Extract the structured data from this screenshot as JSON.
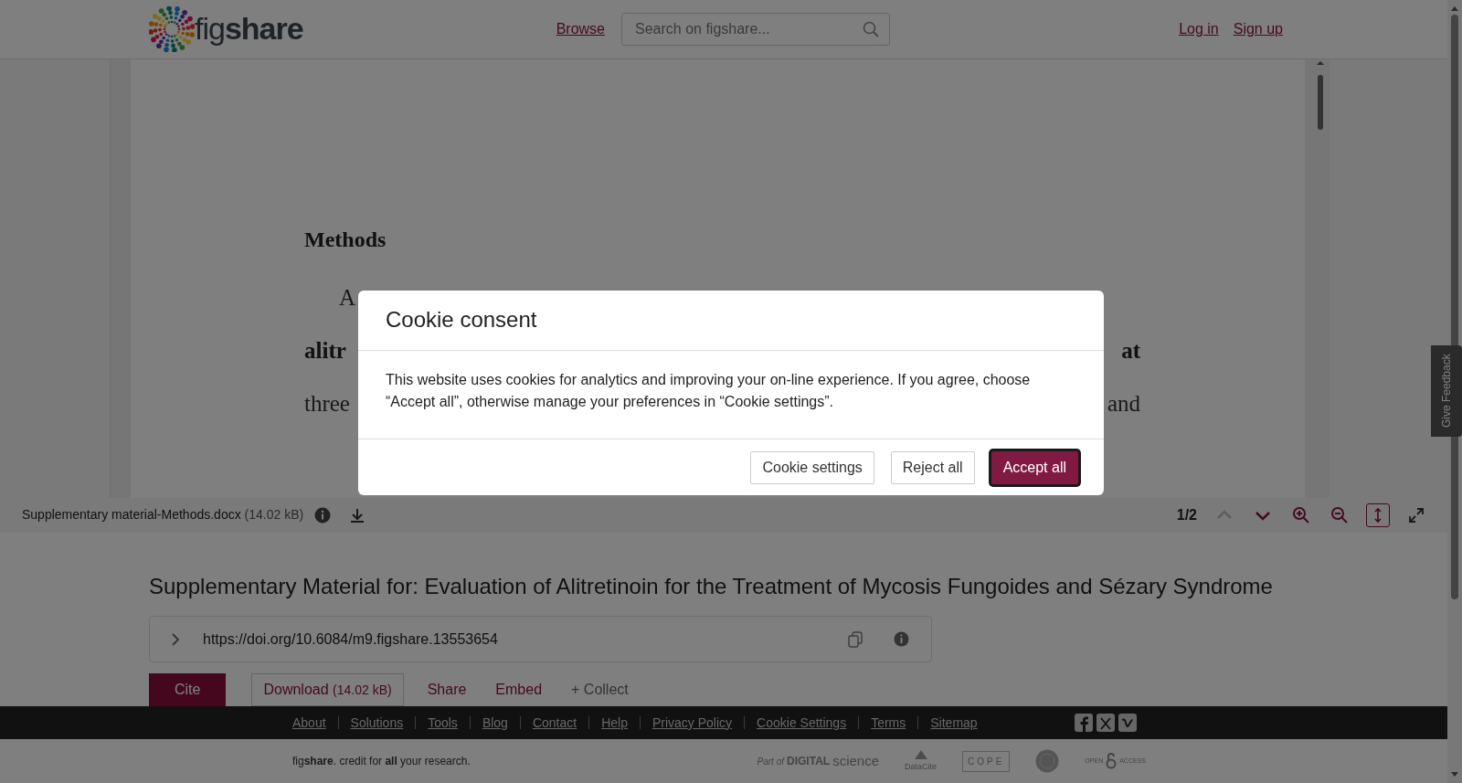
{
  "header": {
    "logo": "fig**share**",
    "nav": [
      {
        "label": "Browse"
      }
    ],
    "search": {
      "placeholder": "Search on figshare..."
    },
    "auth": [
      {
        "label": "Log in"
      },
      {
        "label": "Sign up"
      }
    ]
  },
  "document": {
    "heading": "Methods",
    "lines": [
      {
        "left": "A"
      },
      {
        "left": "alitr",
        "right": "at",
        "bold": true
      },
      {
        "left": "three",
        "right": "and",
        "bold": false
      }
    ]
  },
  "viewer_toolbar": {
    "file_name": "Supplementary material-Methods.docx",
    "file_size": "(14.02 kB)",
    "page": "1/2",
    "tools": [
      {
        "kind": "prev",
        "disabled": true,
        "selected": false
      },
      {
        "kind": "next",
        "disabled": false,
        "selected": false
      },
      {
        "kind": "zoom-in",
        "disabled": false,
        "selected": false
      },
      {
        "kind": "zoom-out",
        "disabled": false,
        "selected": false
      },
      {
        "kind": "fit",
        "disabled": false,
        "selected": true
      },
      {
        "kind": "fullscreen",
        "disabled": false,
        "selected": false
      }
    ]
  },
  "item": {
    "title": "Supplementary Material for: Evaluation of Alitretinoin for the Treatment of Mycosis Fungoides and Sézary Syndrome",
    "doi": "https://doi.org/10.6084/m9.figshare.13553654",
    "actions": [
      {
        "kind": "primary",
        "label": "Cite"
      },
      {
        "kind": "outline",
        "label": "Download",
        "size": "(14.02 kB)"
      },
      {
        "kind": "link",
        "label": "Share"
      },
      {
        "kind": "link",
        "label": "Embed"
      },
      {
        "kind": "muted",
        "label": "+ Collect"
      }
    ]
  },
  "footer": {
    "links": [
      "About",
      "Solutions",
      "Tools",
      "Blog",
      "Contact",
      "Help",
      "Privacy Policy",
      "Cookie Settings",
      "Terms",
      "Sitemap"
    ],
    "tagline": "fig**share**. credit for **all** your research.",
    "partners": [
      {
        "kind": "digital-science",
        "texts": [
          "Part of",
          "DIGITAL",
          "science"
        ]
      },
      {
        "kind": "datacite",
        "texts": [
          "DataCite"
        ]
      },
      {
        "kind": "cope",
        "texts": [
          "COPE"
        ]
      },
      {
        "kind": "seal"
      },
      {
        "kind": "open-access",
        "texts": [
          "OPEN",
          "ACCESS"
        ]
      }
    ]
  },
  "feedback": {
    "label": "Give Feedback"
  },
  "cookie_modal": {
    "title": "Cookie consent",
    "body": "This website uses cookies for analytics and improving your on-line experience. If you agree, choose “Accept all”, otherwise manage your preferences in “Cookie settings”.",
    "buttons": [
      {
        "kind": "outline",
        "label": "Cookie settings",
        "focused": false
      },
      {
        "kind": "outline",
        "label": "Reject all",
        "focused": false
      },
      {
        "kind": "primary",
        "label": "Accept all",
        "focused": true
      }
    ]
  }
}
